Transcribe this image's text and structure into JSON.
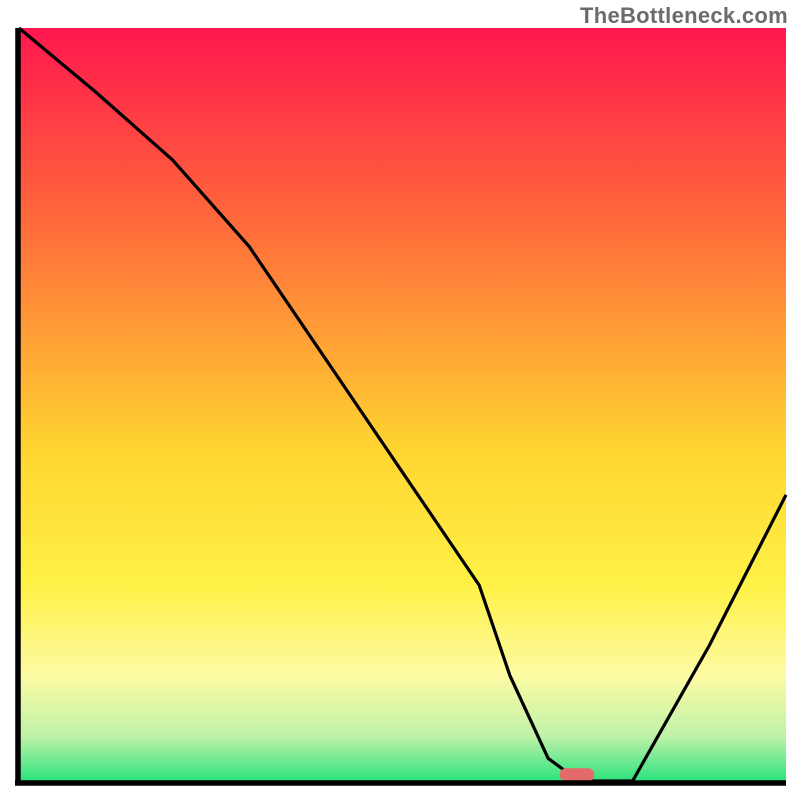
{
  "watermark": "TheBottleneck.com",
  "colors": {
    "grad_top": "#ff174e",
    "grad_mid1": "#ff6a3a",
    "grad_mid2": "#ffd531",
    "grad_mid3": "#fff146",
    "grad_mid4": "#fdfba4",
    "grad_bot1": "#bff2a8",
    "grad_bot2": "#2de37e",
    "curve": "#000000",
    "marker": "#e26a6a",
    "frame": "#000000"
  },
  "chart_data": {
    "type": "line",
    "title": "",
    "xlabel": "",
    "ylabel": "",
    "xlim": [
      0,
      100
    ],
    "ylim": [
      0,
      100
    ],
    "series": [
      {
        "name": "bottleneck-curve",
        "x": [
          0,
          10,
          20,
          30,
          40,
          50,
          60,
          64,
          69,
          73,
          80,
          90,
          100
        ],
        "values": [
          100,
          91.5,
          82.5,
          71,
          56,
          41,
          26,
          14,
          3,
          0,
          0,
          18,
          38
        ]
      }
    ],
    "annotations": [
      {
        "name": "optimal-marker",
        "x0": 70.5,
        "x1": 75,
        "y": 0.9
      }
    ]
  }
}
